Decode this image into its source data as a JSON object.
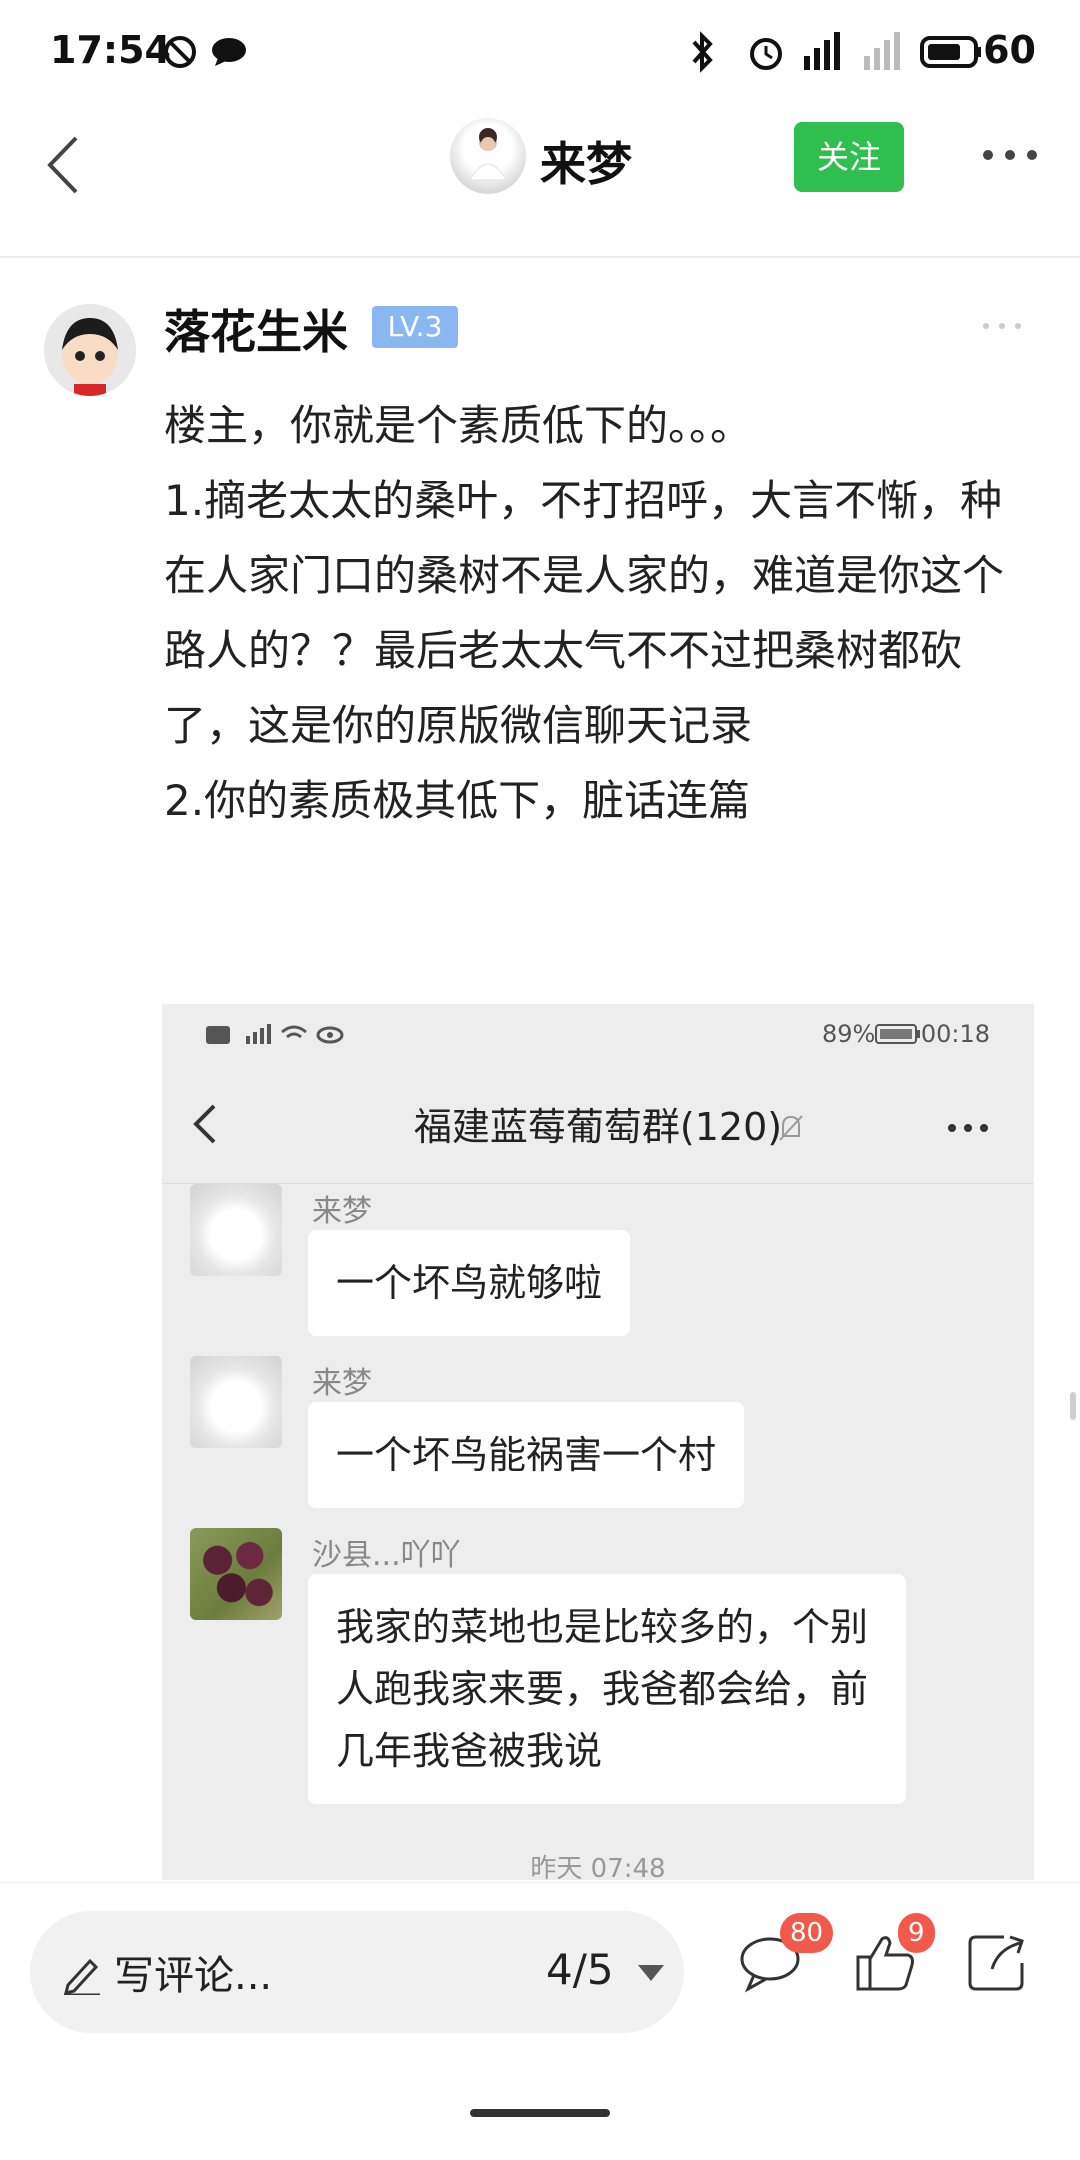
{
  "status_bar": {
    "time": "17:54",
    "battery": "60"
  },
  "nav": {
    "title": "来梦",
    "follow_label": "关注"
  },
  "post": {
    "author": "落花生米",
    "level": "LV.3",
    "lines": [
      "楼主，你就是个素质低下的。。。",
      "1.摘老太太的桑叶，不打招呼，大言不惭，种在人家门口的桑树不是人家的，难道是你这个路人的？？最后老太太气不不过把桑树都砍了，这是你的原版微信聊天记录",
      "2.你的素质极其低下，脏话连篇"
    ]
  },
  "embedded": {
    "status_right": "00:18",
    "battery_pct": "89%",
    "chat_title": "福建蓝莓葡萄群(120)",
    "messages": [
      {
        "name": "来梦",
        "text": "一个坏鸟就够啦"
      },
      {
        "name": "来梦",
        "text": "一个坏鸟能祸害一个村"
      },
      {
        "name": "沙县...吖吖",
        "text": "我家的菜地也是比较多的，个别人跑我家来要，我爸都会给，前几年我爸被我说"
      }
    ],
    "timestamp": "昨天 07:48"
  },
  "bottom_bar": {
    "comment_placeholder": "写评论...",
    "page_indicator": "4/5",
    "comments_count": "80",
    "likes_count": "9"
  },
  "colors": {
    "follow": "#2fbf4f",
    "level": "#8ab6f2",
    "badge": "#f15a4a"
  },
  "icons": [
    "back-icon",
    "more-icon",
    "pencil-icon",
    "dropdown-caret-icon",
    "comment-icon",
    "like-icon",
    "share-icon",
    "mute-bell-icon",
    "bluetooth-icon",
    "alarm-icon",
    "signal-icon",
    "battery-icon"
  ]
}
